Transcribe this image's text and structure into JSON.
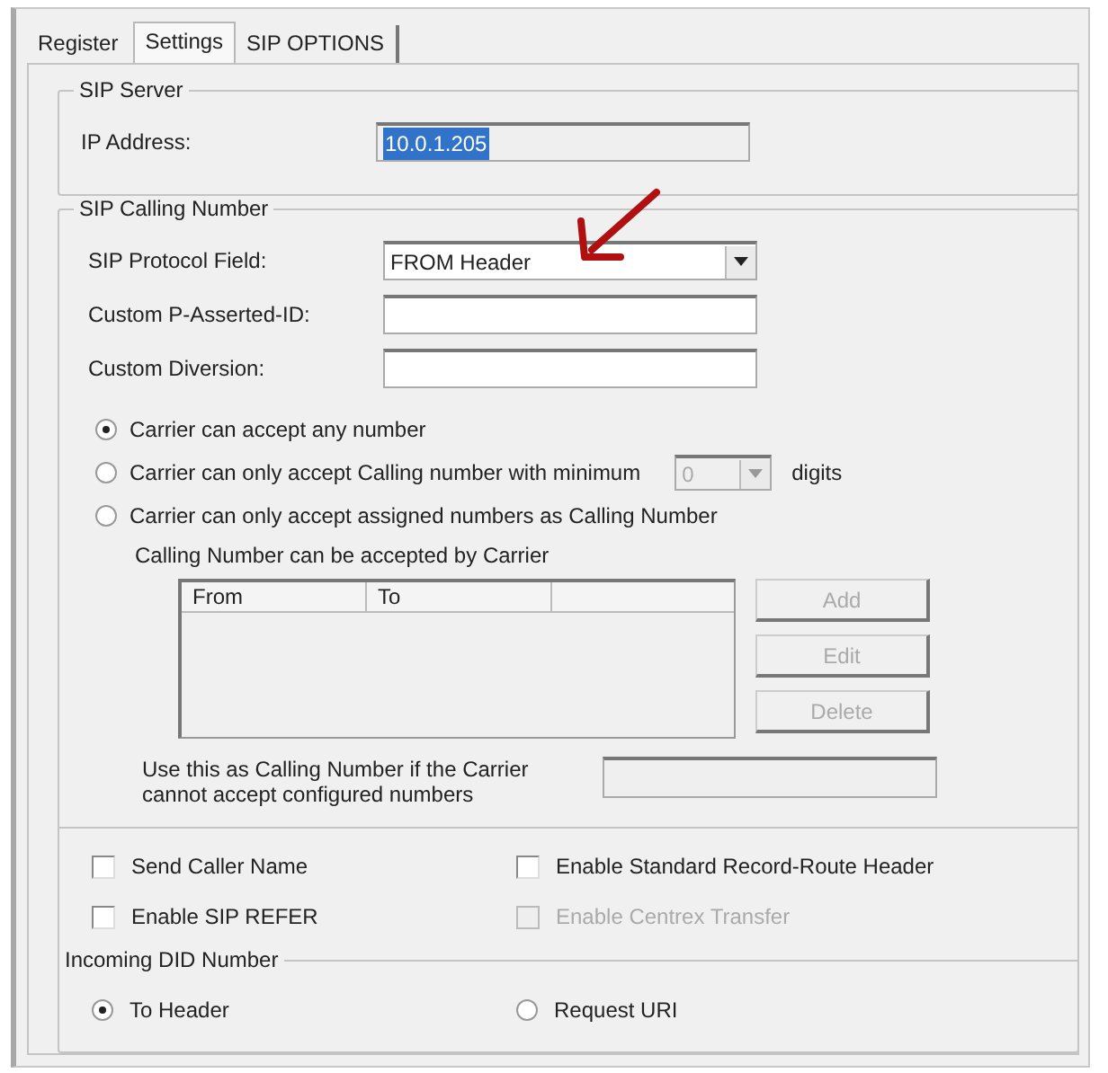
{
  "tabs": [
    {
      "label": "Register",
      "selected": false
    },
    {
      "label": "Settings",
      "selected": true
    },
    {
      "label": "SIP OPTIONS",
      "selected": false
    }
  ],
  "sip_server": {
    "title": "SIP Server",
    "ip_address": {
      "label": "IP Address:",
      "value": "10.0.1.205",
      "text_selected": true
    }
  },
  "sip_calling_number": {
    "title": "SIP Calling Number",
    "fields": [
      {
        "label": "SIP Protocol Field:",
        "kind": "dropdown",
        "value": "FROM Header"
      },
      {
        "label": "Custom P-Asserted-ID:",
        "kind": "text"
      },
      {
        "label": "Custom Diversion:",
        "kind": "text"
      }
    ],
    "acceptance_options": [
      {
        "label": "Carrier can accept any number",
        "selected": true
      },
      {
        "label": "Carrier can only accept Calling number with minimum",
        "selected": false,
        "digits": {
          "value": "0",
          "disabled": true,
          "suffix": "digits"
        }
      },
      {
        "label": "Carrier can only accept assigned numbers as Calling Number",
        "selected": false
      }
    ],
    "list_caption": "Calling Number can be accepted by Carrier",
    "list_columns": [
      "From",
      "To"
    ],
    "list_buttons": [
      {
        "label": "Add",
        "disabled": true
      },
      {
        "label": "Edit",
        "disabled": true
      },
      {
        "label": "Delete",
        "disabled": true
      }
    ],
    "fallback": {
      "label": "Use this as Calling Number if the Carrier cannot accept configured numbers",
      "disabled": true
    }
  },
  "options": [
    {
      "label": "Send Caller Name",
      "checked": false,
      "disabled": false
    },
    {
      "label": "Enable Standard Record-Route Header",
      "checked": false,
      "disabled": false
    },
    {
      "label": "Enable SIP REFER",
      "checked": false,
      "disabled": false
    },
    {
      "label": "Enable Centrex Transfer",
      "checked": false,
      "disabled": true
    }
  ],
  "incoming_did_number": {
    "title": "Incoming DID Number",
    "options": [
      {
        "label": "To Header",
        "selected": true
      },
      {
        "label": "Request URI",
        "selected": false
      }
    ]
  }
}
